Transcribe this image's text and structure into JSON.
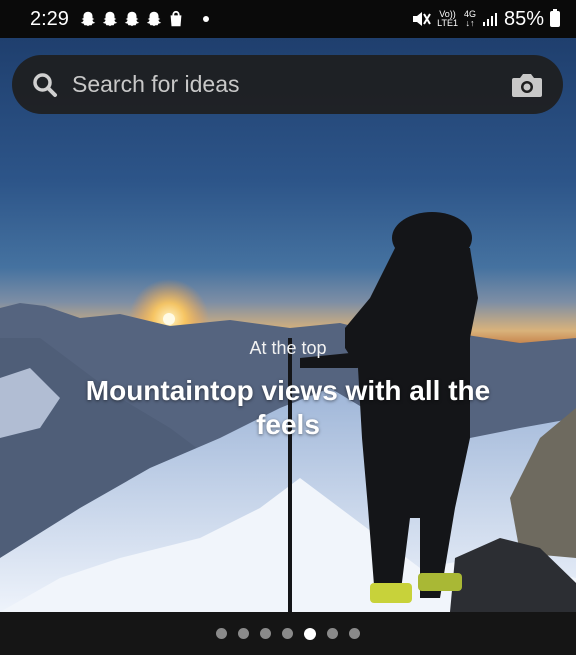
{
  "status": {
    "time": "2:29",
    "network_top": "Vo))",
    "network_bottom": "LTE1",
    "network_gen": "4G",
    "battery": "85%"
  },
  "search": {
    "placeholder": "Search for ideas"
  },
  "hero": {
    "subtitle": "At the top",
    "headline": "Mountaintop views with all the feels"
  },
  "pager": {
    "count": 7,
    "active_index": 4
  },
  "icons": [
    "snapchat-icon",
    "shopping-bag-icon",
    "mute-icon",
    "signal-icon",
    "battery-icon",
    "search-icon",
    "camera-icon"
  ]
}
